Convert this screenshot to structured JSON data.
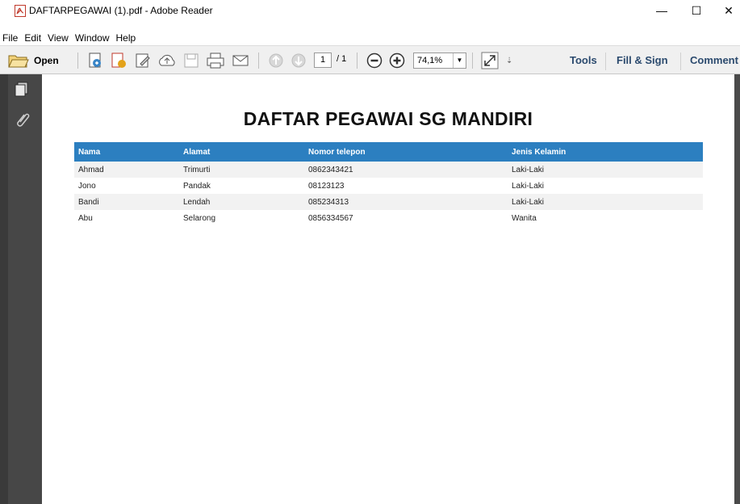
{
  "window": {
    "title": "DAFTARPEGAWAI (1).pdf - Adobe Reader",
    "min_glyph": "—",
    "max_glyph": "☐",
    "close_glyph": "✕"
  },
  "menu": [
    "File",
    "Edit",
    "View",
    "Window",
    "Help"
  ],
  "toolbar": {
    "open_label": "Open",
    "page_current": "1",
    "page_total": "/ 1",
    "zoom_value": "74,1%",
    "tools_label": "Tools",
    "fill_sign_label": "Fill & Sign",
    "comment_label": "Comment"
  },
  "document": {
    "title": "DAFTAR PEGAWAI SG MANDIRI",
    "header_color": "#2c7fc0",
    "columns": [
      "Nama",
      "Alamat",
      "Nomor telepon",
      "Jenis Kelamin"
    ],
    "rows": [
      [
        "Ahmad",
        "Trimurti",
        "0862343421",
        "Laki-Laki"
      ],
      [
        "Jono",
        "Pandak",
        "08123123",
        "Laki-Laki"
      ],
      [
        "Bandi",
        "Lendah",
        "085234313",
        "Laki-Laki"
      ],
      [
        "Abu",
        "Selarong",
        "0856334567",
        "Wanita"
      ]
    ]
  }
}
